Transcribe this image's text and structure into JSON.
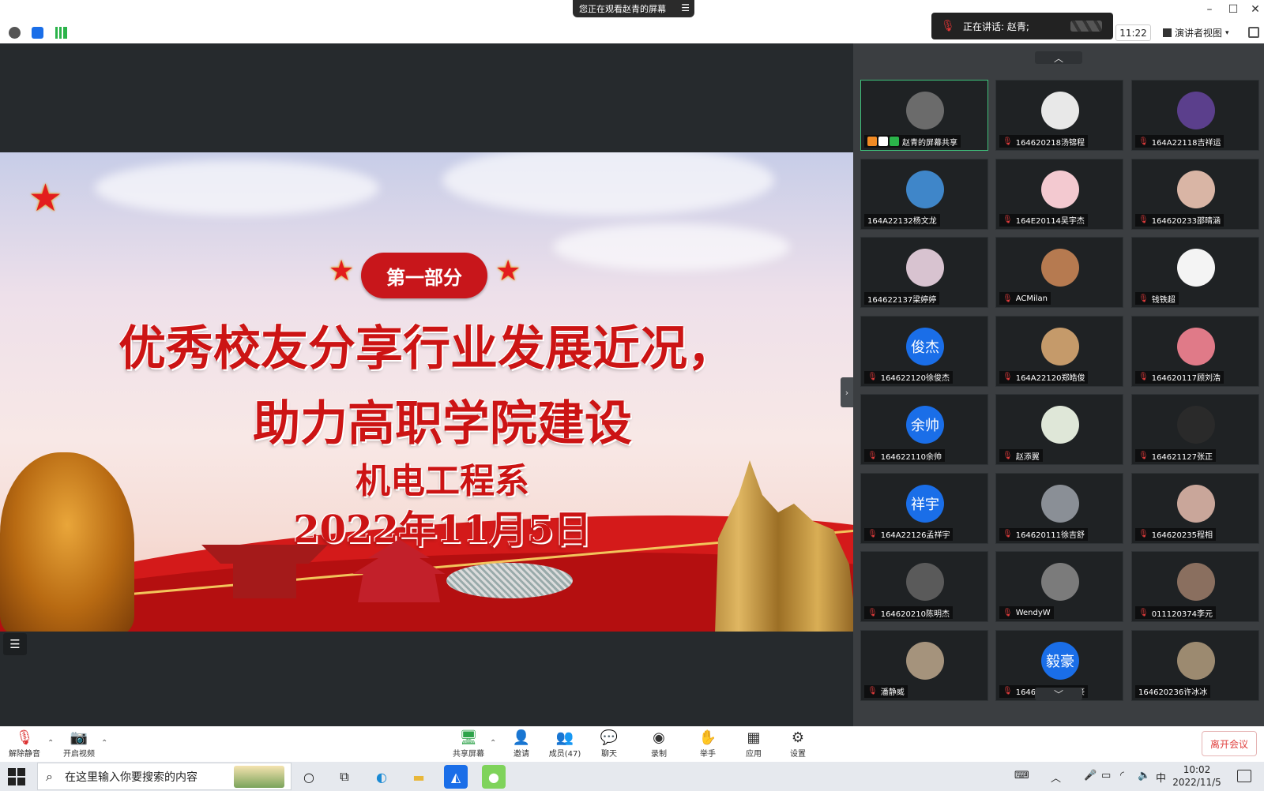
{
  "window": {
    "viewing_banner": "您正在观看赵青的屏幕",
    "speaking_label": "正在讲话: 赵青;",
    "meeting_time": "11:22",
    "view_mode": "演讲者视图"
  },
  "slide": {
    "section_label": "第一部分",
    "title_line1": "优秀校友分享行业发展近况，",
    "title_line2": "助力高职学院建设",
    "department": "机电工程系",
    "date": "2022年11月5日"
  },
  "gallery": {
    "participants": [
      {
        "name": "赵青的屏幕共享",
        "avatar_text": "",
        "avatar_color": "#6b6b6b",
        "muted": false,
        "active": true
      },
      {
        "name": "164620218汤锦程",
        "avatar_text": "",
        "avatar_color": "#e8e8e8",
        "muted": true
      },
      {
        "name": "164A22118吉祥运",
        "avatar_text": "",
        "avatar_color": "#5b3f8c",
        "muted": true
      },
      {
        "name": "164A22132杨文龙",
        "avatar_text": "",
        "avatar_color": "#3f86c9",
        "muted": false
      },
      {
        "name": "164E20114吴宇杰",
        "avatar_text": "",
        "avatar_color": "#f3c9d0",
        "muted": true
      },
      {
        "name": "164620233邵晴涵",
        "avatar_text": "",
        "avatar_color": "#d9b5a5",
        "muted": true
      },
      {
        "name": "164622137梁婷婷",
        "avatar_text": "",
        "avatar_color": "#d8c3d0",
        "muted": false
      },
      {
        "name": "ACMilan",
        "avatar_text": "",
        "avatar_color": "#b67a50",
        "muted": true
      },
      {
        "name": "钱铁超",
        "avatar_text": "",
        "avatar_color": "#f4f4f4",
        "muted": true
      },
      {
        "name": "164622120徐俊杰",
        "avatar_text": "俊杰",
        "avatar_color": "#1a6ee8",
        "muted": true
      },
      {
        "name": "164A22120郑皓俊",
        "avatar_text": "",
        "avatar_color": "#c59a6a",
        "muted": true
      },
      {
        "name": "164620117顾刘浩",
        "avatar_text": "",
        "avatar_color": "#e07a88",
        "muted": true
      },
      {
        "name": "164622110余帅",
        "avatar_text": "余帅",
        "avatar_color": "#1a6ee8",
        "muted": true
      },
      {
        "name": "赵添翼",
        "avatar_text": "",
        "avatar_color": "#dfe7d8",
        "muted": true
      },
      {
        "name": "164621127张正",
        "avatar_text": "",
        "avatar_color": "#2a2a2a",
        "muted": true
      },
      {
        "name": "164A22126孟祥宇",
        "avatar_text": "祥宇",
        "avatar_color": "#1a6ee8",
        "muted": true
      },
      {
        "name": "164620111徐吉舒",
        "avatar_text": "",
        "avatar_color": "#8a8f96",
        "muted": true
      },
      {
        "name": "164620235程相",
        "avatar_text": "",
        "avatar_color": "#c9a69a",
        "muted": true
      },
      {
        "name": "164620210陈明杰",
        "avatar_text": "",
        "avatar_color": "#5a5a5a",
        "muted": true
      },
      {
        "name": "WendyW",
        "avatar_text": "",
        "avatar_color": "#7b7b7b",
        "muted": true
      },
      {
        "name": "011120374李元",
        "avatar_text": "",
        "avatar_color": "#8a6f5f",
        "muted": true
      },
      {
        "name": "潘静威",
        "avatar_text": "",
        "avatar_color": "#a5937c",
        "muted": true
      },
      {
        "name": "164621215孙毅豪",
        "avatar_text": "毅豪",
        "avatar_color": "#1a6ee8",
        "muted": true
      },
      {
        "name": "164620236许冰冰",
        "avatar_text": "",
        "avatar_color": "#9c8a70",
        "muted": false
      }
    ]
  },
  "meeting_toolbar": {
    "unmute": "解除静音",
    "start_video": "开启视频",
    "share_screen": "共享屏幕",
    "invite": "邀请",
    "members": "成员(47)",
    "chat": "聊天",
    "record": "录制",
    "raise_hand": "举手",
    "apps": "应用",
    "settings": "设置",
    "leave": "离开会议"
  },
  "taskbar": {
    "search_placeholder": "在这里输入你要搜索的内容",
    "ime": "中",
    "time": "10:02",
    "date": "2022/11/5"
  }
}
